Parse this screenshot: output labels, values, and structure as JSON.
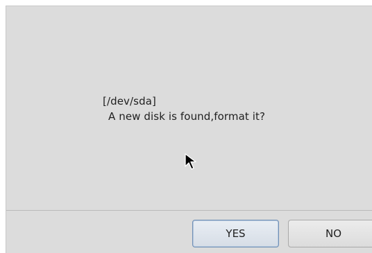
{
  "dialog": {
    "message": {
      "device": "[/dev/sda]",
      "question": "A new disk is found,format it?"
    },
    "buttons": {
      "yes_label": "YES",
      "no_label": "NO"
    }
  },
  "pointer": {
    "icon": "arrow-cursor-icon"
  },
  "colors": {
    "dialog_background": "#dcdcdc",
    "primary_button_border": "#6f8fb6"
  }
}
